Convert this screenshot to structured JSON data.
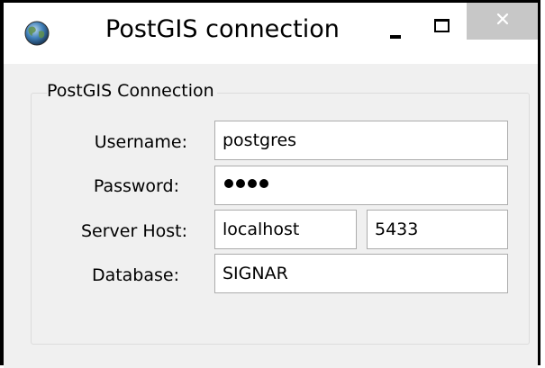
{
  "window": {
    "title": "PostGIS connection"
  },
  "group": {
    "legend": "PostGIS Connection"
  },
  "form": {
    "username": {
      "label": "Username:",
      "value": "postgres"
    },
    "password": {
      "label": "Password:",
      "masked_length": 4
    },
    "server_host": {
      "label": "Server Host:",
      "host_value": "localhost",
      "port_value": "5433"
    },
    "database": {
      "label": "Database:",
      "value": "SIGNAR"
    }
  }
}
